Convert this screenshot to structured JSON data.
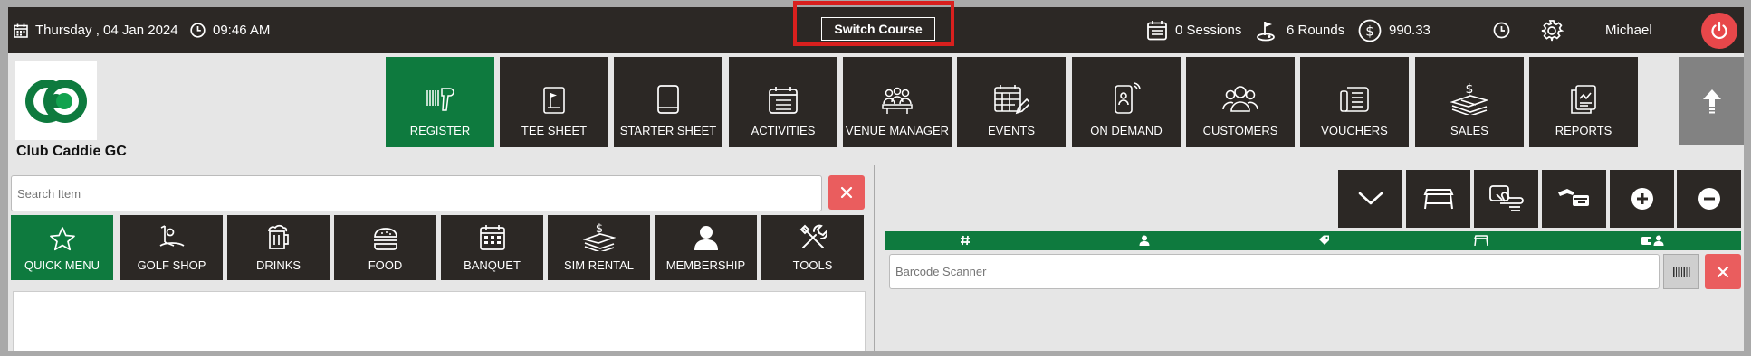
{
  "topbar": {
    "date": "Thursday ,  04 Jan 2024",
    "time": "09:46 AM",
    "switch_course": "Switch Course",
    "sessions": "0 Sessions",
    "rounds": "6 Rounds",
    "balance": "990.33",
    "user": "Michael"
  },
  "club": {
    "name": "Club Caddie GC"
  },
  "nav": [
    {
      "label": "REGISTER",
      "icon": "barcode-scanner-icon"
    },
    {
      "label": "TEE SHEET",
      "icon": "tee-sheet-icon"
    },
    {
      "label": "STARTER SHEET",
      "icon": "tablet-icon"
    },
    {
      "label": "ACTIVITIES",
      "icon": "calendar-list-icon"
    },
    {
      "label": "VENUE MANAGER",
      "icon": "people-table-icon"
    },
    {
      "label": "EVENTS",
      "icon": "calendar-edit-icon"
    },
    {
      "label": "ON DEMAND",
      "icon": "phone-person-icon"
    },
    {
      "label": "CUSTOMERS",
      "icon": "users-icon"
    },
    {
      "label": "VOUCHERS",
      "icon": "voucher-icon"
    },
    {
      "label": "SALES",
      "icon": "money-stack-icon"
    },
    {
      "label": "REPORTS",
      "icon": "report-icon"
    }
  ],
  "search": {
    "placeholder": "Search Item"
  },
  "categories": [
    {
      "label": "QUICK MENU",
      "icon": "star-icon"
    },
    {
      "label": "GOLF SHOP",
      "icon": "golf-icon"
    },
    {
      "label": "DRINKS",
      "icon": "beer-icon"
    },
    {
      "label": "FOOD",
      "icon": "burger-icon"
    },
    {
      "label": "BANQUET",
      "icon": "calendar-grid-icon"
    },
    {
      "label": "SIM RENTAL",
      "icon": "money-stack-icon"
    },
    {
      "label": "MEMBERSHIP",
      "icon": "person-icon"
    },
    {
      "label": "TOOLS",
      "icon": "tools-icon"
    }
  ],
  "barcode": {
    "placeholder": "Barcode Scanner"
  },
  "colors": {
    "dark": "#2c2825",
    "green": "#0e7a3e",
    "red": "#e8474a",
    "accent_border": "#d9201e"
  }
}
